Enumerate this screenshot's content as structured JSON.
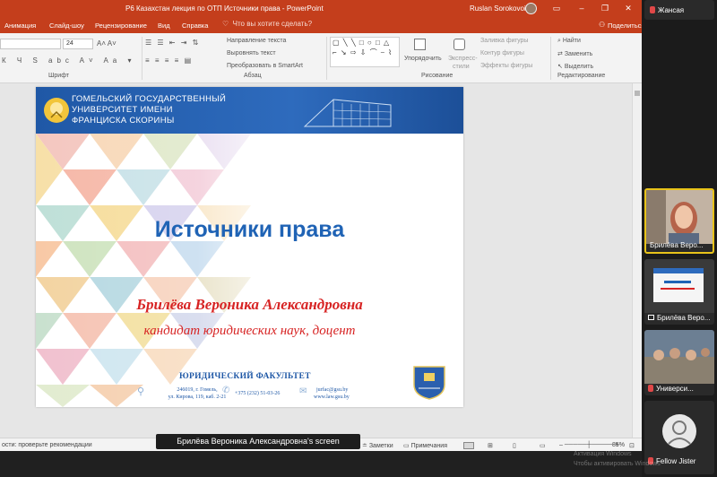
{
  "window": {
    "title": "Р6 Казахстан лекция по ОТП Источники права  -  PowerPoint",
    "user": "Ruslan Sorokovoi"
  },
  "ribbon_tabs": [
    "Анимация",
    "Слайд-шоу",
    "Рецензирование",
    "Вид",
    "Справка"
  ],
  "tell_me": "Что вы хотите сделать?",
  "share": "Поделиться",
  "ribbon": {
    "font_size": "24",
    "font_group": "Шрифт",
    "paragraph_group": "Абзац",
    "drawing_group": "Рисование",
    "editing_group": "Редактирование",
    "text_direction": "Направление текста",
    "align_text": "Выровнять текст",
    "convert_smartart": "Преобразовать в SmartArt",
    "arrange": "Упорядочить",
    "quick_styles_1": "Экспресс-",
    "quick_styles_2": "стили",
    "shape_fill": "Заливка фигуры",
    "shape_outline": "Контур фигуры",
    "shape_effects": "Эффекты фигуры",
    "find": "Найти",
    "replace": "Заменить",
    "select": "Выделить"
  },
  "slide": {
    "university_line1": "ГОМЕЛЬСКИЙ ГОСУДАРСТВЕННЫЙ",
    "university_line2": "УНИВЕРСИТЕТ ИМЕНИ",
    "university_line3": "ФРАНЦИСКА СКОРИНЫ",
    "title": "Источники права",
    "author": "Брилёва Вероника Александровна",
    "degree": "кандидат юридических наук, доцент",
    "faculty": "ЮРИДИЧЕСКИЙ ФАКУЛЬТЕТ",
    "address_line1": "246019, г. Гомель,",
    "address_line2": "ул. Кирова, 119, каб. 2-21",
    "phone": "+375 (232) 51-03-26",
    "email": "jurfac@gsu.by",
    "website": "www.law.gsu.by"
  },
  "statusbar": {
    "accessibility": "ости: проверьте рекомендации",
    "notes": "Заметки",
    "comments": "Примечания",
    "zoom": "85%"
  },
  "screen_share_label": "Брилёва Вероника Александровна's screen",
  "participants": [
    {
      "name": "Жансая"
    },
    {
      "name": "Брилёва Веро..."
    },
    {
      "name": "Брилёва Веро..."
    },
    {
      "name": "Универси..."
    },
    {
      "name": "Fellow Jister"
    }
  ],
  "watermark_line1": "Активация Windows",
  "watermark_line2": "Чтобы активировать Windows"
}
